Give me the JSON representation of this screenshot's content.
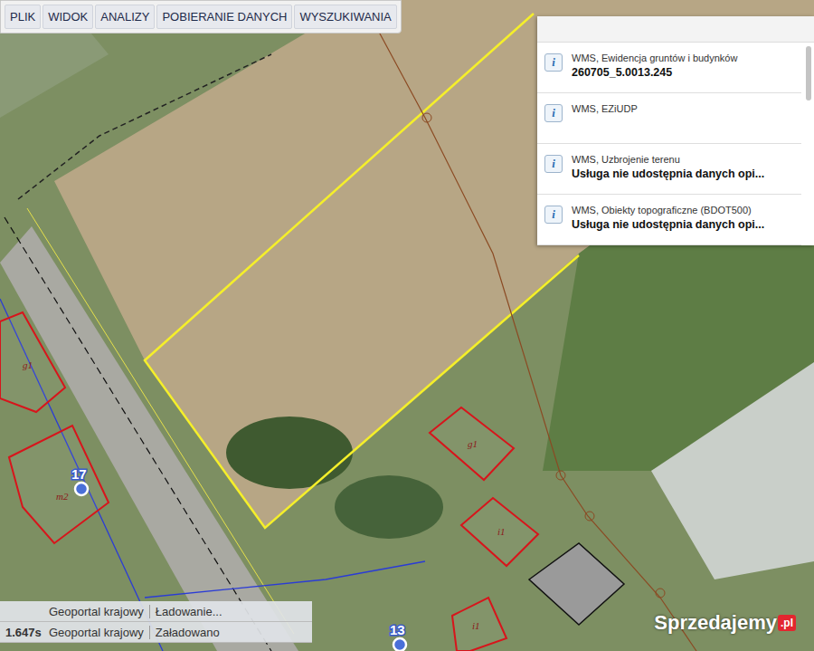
{
  "menu": [
    {
      "label": "PLIK"
    },
    {
      "label": "WIDOK"
    },
    {
      "label": "ANALIZY"
    },
    {
      "label": "POBIERANIE DANYCH"
    },
    {
      "label": "WYSZUKIWANIA"
    }
  ],
  "info_panel": {
    "items": [
      {
        "icon": "i",
        "layer": "WMS, Ewidencja gruntów i budynków",
        "value": "260705_5.0013.245"
      },
      {
        "icon": "i",
        "layer": "WMS, EZiUDP"
      },
      {
        "icon": "i",
        "layer": "WMS, Uzbrojenie terenu",
        "value": "Usługa nie udostępnia danych opi..."
      },
      {
        "icon": "i",
        "layer": "WMS, Obiekty topograficzne (BDOT500)",
        "value": "Usługa nie udostępnia danych opi..."
      }
    ]
  },
  "map": {
    "buildings": [
      {
        "label": "g1"
      },
      {
        "label": "i1"
      },
      {
        "label": "g1"
      },
      {
        "label": "m2"
      },
      {
        "label": "i1"
      }
    ],
    "address_pins": [
      {
        "label": "17"
      },
      {
        "label": "13"
      }
    ]
  },
  "status_bar": [
    {
      "time": "",
      "source": "Geoportal krajowy",
      "status": "Ładowanie..."
    },
    {
      "time": "1.647s",
      "source": "Geoportal krajowy",
      "status": "Załadowano"
    }
  ],
  "watermark": {
    "name": "Sprzedajemy",
    "suffix": ".pl"
  }
}
